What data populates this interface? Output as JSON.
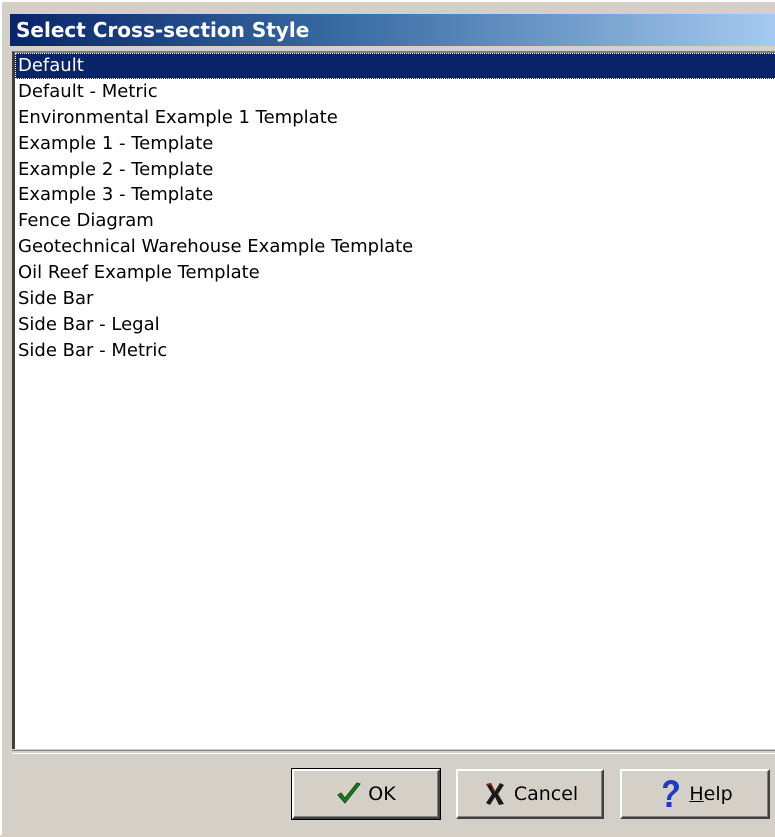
{
  "window": {
    "title": "Select Cross-section Style"
  },
  "list": {
    "selected_index": 0,
    "items": [
      "Default",
      "Default - Metric",
      "Environmental Example 1 Template",
      "Example 1 - Template",
      "Example 2 - Template",
      "Example 3 - Template",
      "Fence Diagram",
      "Geotechnical Warehouse Example Template",
      "Oil Reef Example Template",
      "Side Bar",
      "Side Bar - Legal",
      "Side Bar - Metric"
    ]
  },
  "buttons": {
    "ok_label": "OK",
    "ok_icon": "checkmark-icon",
    "cancel_label": "Cancel",
    "cancel_icon": "x-icon",
    "help_label": "Help",
    "help_icon": "question-mark-icon"
  },
  "colors": {
    "selection": "#0a246a",
    "title_gradient_start": "#0a246a",
    "title_gradient_end": "#a6caf0",
    "ok_check": "#1e7a1e",
    "cancel_x": "#1a1a1a",
    "help_question": "#1c3cc8"
  }
}
